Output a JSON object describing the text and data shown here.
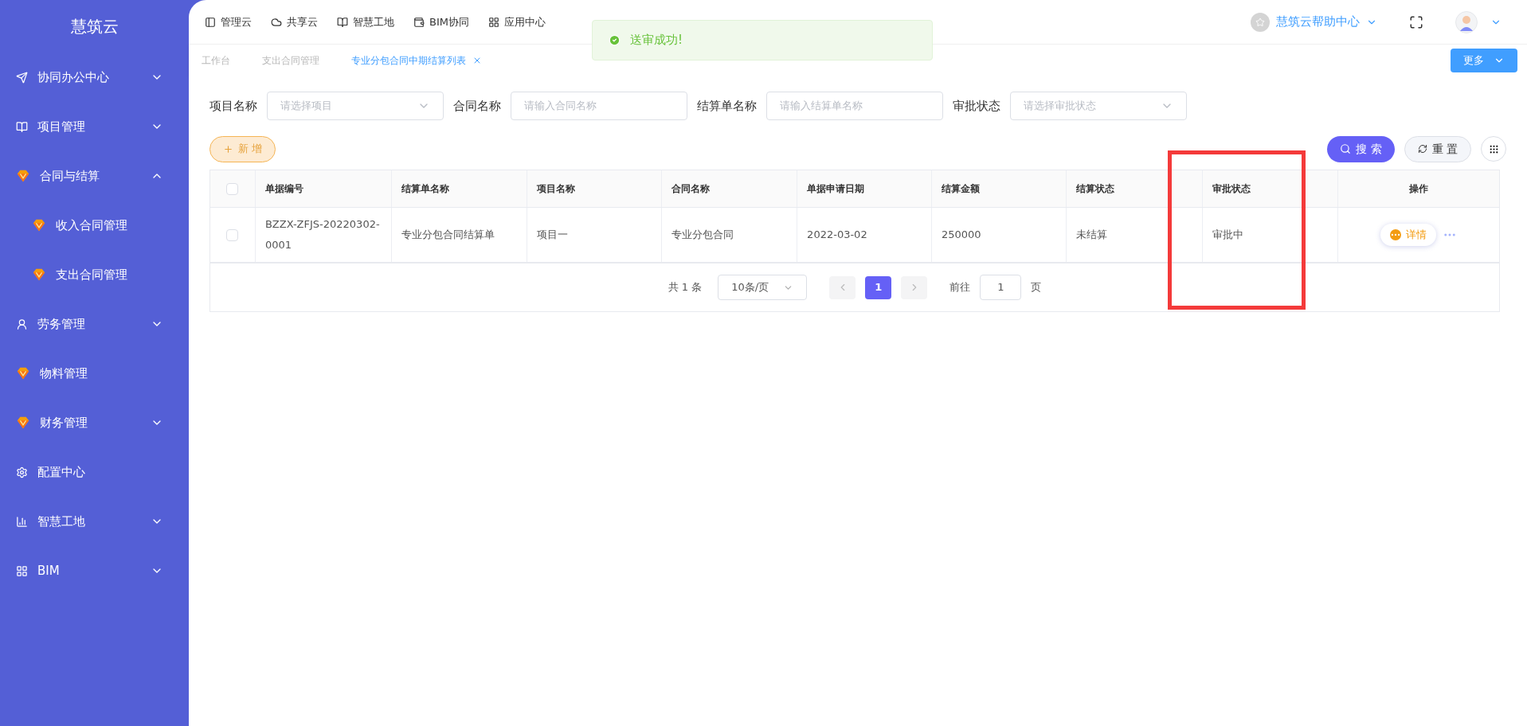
{
  "sidebar": {
    "logo": "慧筑云",
    "items": [
      {
        "label": "协同办公中心",
        "kind": "send",
        "expanded": false
      },
      {
        "label": "项目管理",
        "kind": "book",
        "expanded": false
      },
      {
        "label": "合同与结算",
        "kind": "gem",
        "expanded": true,
        "children": [
          {
            "label": "收入合同管理",
            "kind": "gem"
          },
          {
            "label": "支出合同管理",
            "kind": "gem"
          }
        ]
      },
      {
        "label": "劳务管理",
        "kind": "user",
        "expanded": false
      },
      {
        "label": "物料管理",
        "kind": "gem"
      },
      {
        "label": "财务管理",
        "kind": "gem",
        "expanded": false
      },
      {
        "label": "配置中心",
        "kind": "gear"
      },
      {
        "label": "智慧工地",
        "kind": "chart",
        "expanded": false
      },
      {
        "label": "BIM",
        "kind": "grid",
        "expanded": false
      }
    ]
  },
  "top_nav": {
    "items": [
      {
        "label": "管理云",
        "kind": "panel"
      },
      {
        "label": "共享云",
        "kind": "cloud"
      },
      {
        "label": "智慧工地",
        "kind": "book"
      },
      {
        "label": "BIM协同",
        "kind": "wallet"
      },
      {
        "label": "应用中心",
        "kind": "grid"
      }
    ],
    "help": "慧筑云帮助中心"
  },
  "toast": {
    "message": "送审成功!"
  },
  "tabs": [
    {
      "label": "工作台",
      "selected": false
    },
    {
      "label": "支出合同管理",
      "selected": false
    },
    {
      "label": "专业分包合同中期结算列表",
      "selected": true,
      "closable": true
    }
  ],
  "more_button": "更多",
  "filters": [
    {
      "label": "项目名称",
      "placeholder": "请选择项目",
      "kind": "select"
    },
    {
      "label": "合同名称",
      "placeholder": "请输入合同名称",
      "kind": "input"
    },
    {
      "label": "结算单名称",
      "placeholder": "请输入结算单名称",
      "kind": "input"
    },
    {
      "label": "审批状态",
      "placeholder": "请选择审批状态",
      "kind": "select"
    }
  ],
  "add_button": "新 增",
  "search_button": "搜 索",
  "reset_button": "重 置",
  "table": {
    "select_all_checked": false,
    "columns": [
      "单据编号",
      "结算单名称",
      "项目名称",
      "合同名称",
      "单据申请日期",
      "结算金额",
      "结算状态",
      "审批状态",
      "操作"
    ],
    "rows": [
      {
        "checked": false,
        "cells": [
          "BZZX-ZFJS-20220302-0001",
          "专业分包合同结算单",
          "项目一",
          "专业分包合同",
          "2022-03-02",
          "250000",
          "未结算",
          "审批中"
        ],
        "action": "详情"
      }
    ]
  },
  "pagination": {
    "total": "共 1 条",
    "page_size": "10条/页",
    "pages": [
      {
        "label": "1",
        "selected": true
      }
    ],
    "goto_label": "前往",
    "goto_value": "1",
    "goto_suffix": "页"
  }
}
